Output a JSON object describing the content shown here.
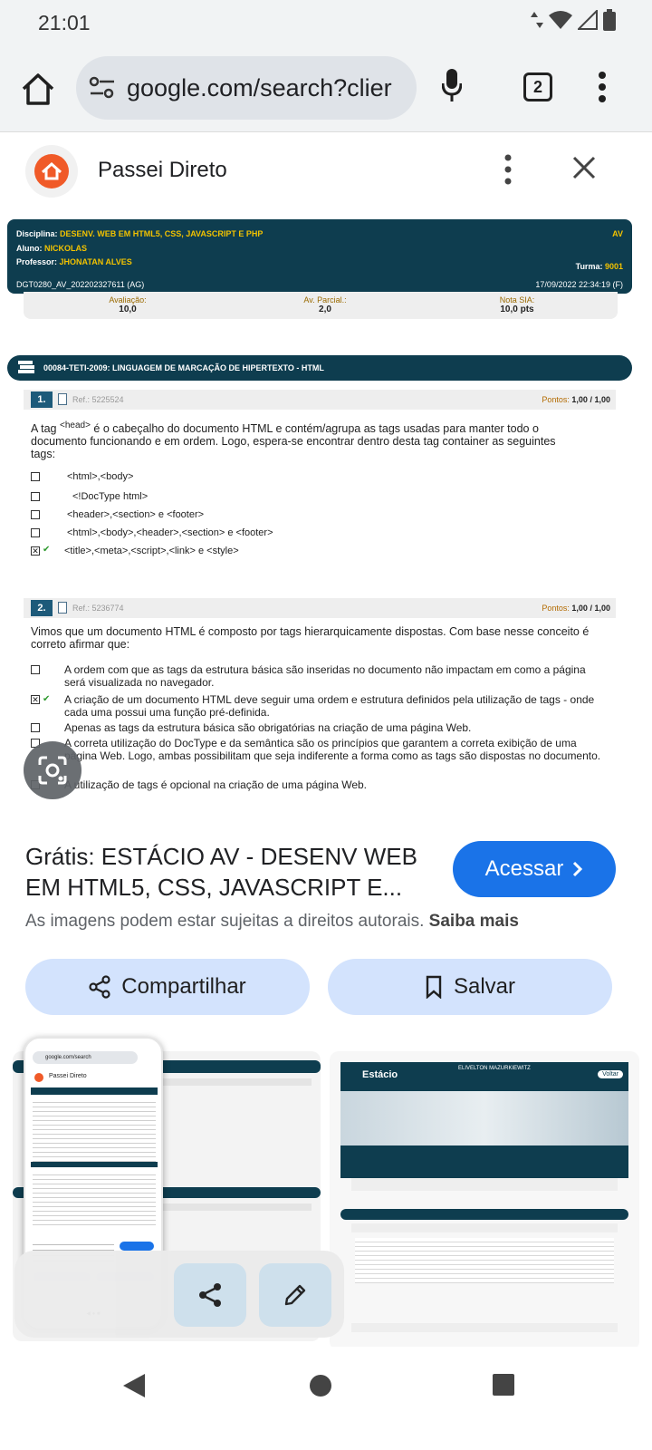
{
  "status_bar": {
    "time": "21:01"
  },
  "browser": {
    "url": "google.com/search?clier",
    "tab_count": "2"
  },
  "lens_header": {
    "site_name": "Passei Direto"
  },
  "document": {
    "header": {
      "disciplina_label": "Disciplina:",
      "disciplina": "DESENV. WEB EM HTML5, CSS, JAVASCRIPT E PHP",
      "av": "AV",
      "aluno_label": "Aluno:",
      "aluno": "NICKOLAS",
      "professor_label": "Professor:",
      "professor": "JHONATAN ALVES",
      "turma_label": "Turma:",
      "turma": "9001",
      "code": "DGT0280_AV_202202327611 (AG)",
      "datetime": "17/09/2022 22:34:19 (F)"
    },
    "grades": [
      {
        "label": "Avaliação:",
        "value": "10,0"
      },
      {
        "label": "Av. Parcial.:",
        "value": "2,0"
      },
      {
        "label": "Nota SIA:",
        "value": "10,0 pts"
      }
    ],
    "section_title": "00084-TETI-2009: LINGUAGEM DE MARCAÇÃO DE HIPERTEXTO - HTML",
    "q1": {
      "number": "1.",
      "ref": "Ref.: 5225524",
      "points_label": "Pontos:",
      "points": "1,00",
      "points_total": "/ 1,00",
      "text_a": "A tag",
      "text_tag": "<head>",
      "text_b": "é o cabeçalho do documento HTML e contém/agrupa as tags usadas para manter todo o",
      "text_c": "documento funcionando e em ordem. Logo, espera-se encontrar dentro desta tag container as seguintes",
      "text_d": "tags:",
      "options": [
        "<html>,<body>",
        "<!DocType html>",
        "<header>,<section> e <footer>",
        "<html>,<body>,<header>,<section> e <footer>",
        "<title>,<meta>,<script>,<link> e <style>"
      ]
    },
    "q2": {
      "number": "2.",
      "ref": "Ref.: 5236774",
      "points_label": "Pontos:",
      "points": "1,00",
      "points_total": "/ 1,00",
      "text": "Vimos que um documento HTML é composto por tags hierarquicamente dispostas. Com base nesse conceito é correto afirmar que:",
      "options": [
        "A ordem com que as tags da estrutura básica são inseridas no documento não impactam em como a página será visualizada no navegador.",
        "A criação de um documento HTML deve seguir uma ordem e estrutura definidos pela utilização de tags - onde cada uma possui uma função pré-definida.",
        "Apenas as tags da estrutura básica são obrigatórias na criação de uma página Web.",
        "A correta utilização do DocType e da semântica são os princípios que garantem a correta exibição de uma página Web. Logo, ambas possibilitam que seja indiferente a forma como as tags são dispostas no documento.",
        "A utilização de tags é opcional na criação de uma página Web."
      ]
    }
  },
  "result": {
    "title": "Grátis: ESTÁCIO AV - DESENV WEB EM HTML5, CSS, JAVASCRIPT E...",
    "access_label": "Acessar",
    "copyright_text": "As imagens podem estar sujeitas a direitos autorais.",
    "learn_more": "Saiba mais",
    "share_label": "Compartilhar",
    "save_label": "Salvar"
  },
  "thumbnails": {
    "mini_site": "Passei Direto",
    "mini_url": "google.com/search",
    "right_brand": "Estácio",
    "right_student": "ELIVELTON MAZURKIEWITZ",
    "right_back": "Voltar"
  },
  "colors": {
    "doc_header": "#0e3d4f",
    "accent_blue": "#1a73e8",
    "pill_bg": "#d3e3fd",
    "brand_orange": "#f05a28"
  }
}
